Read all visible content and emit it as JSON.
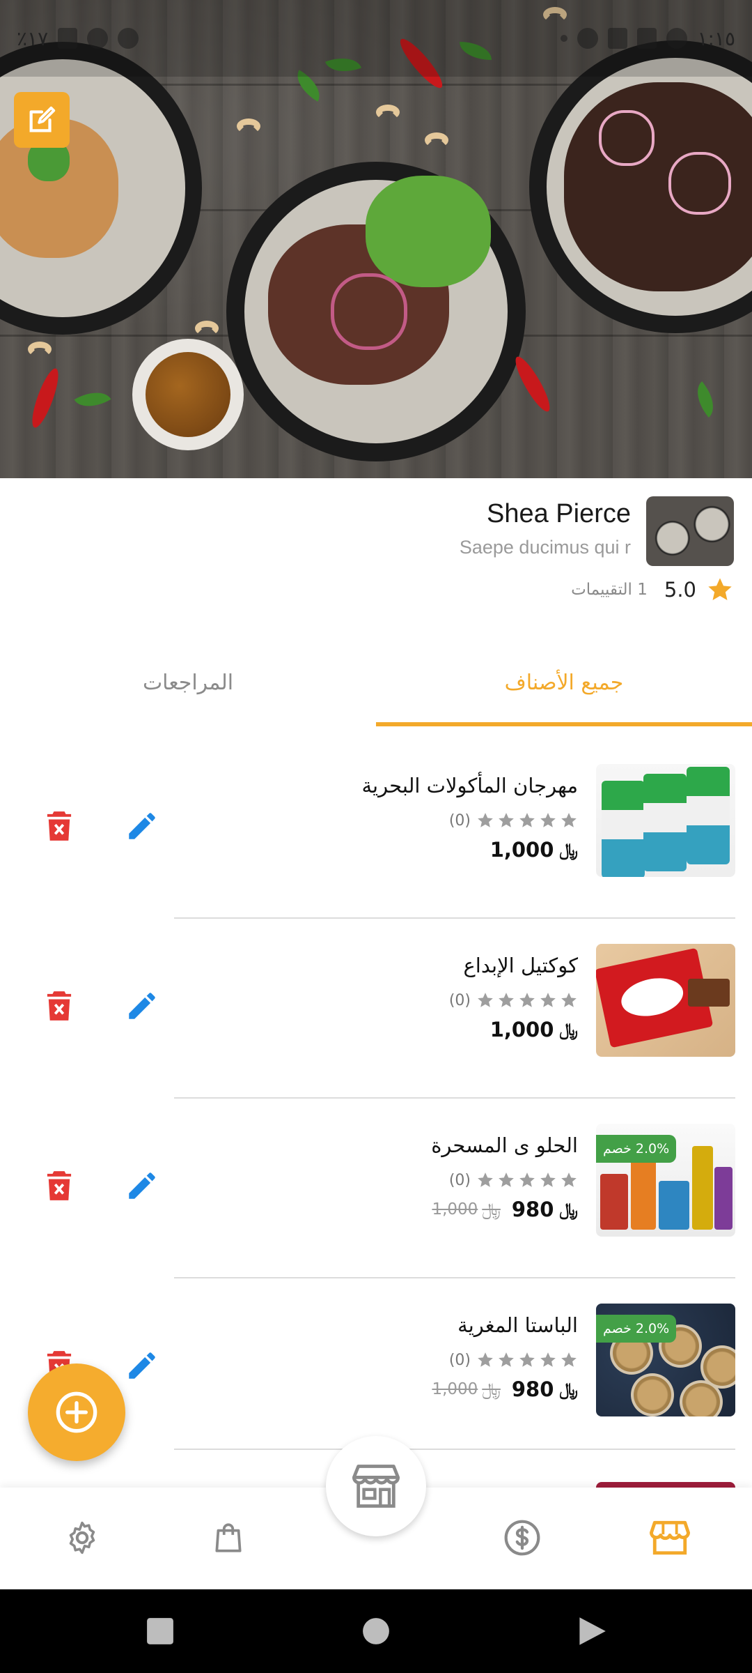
{
  "status_bar": {
    "battery": "٪١٧",
    "time": "١:١٥"
  },
  "store": {
    "name": "Shea Pierce",
    "description": "Saepe ducimus qui r",
    "rating_value": "5.0",
    "rating_count": "1 التقييمات"
  },
  "tabs": [
    {
      "label": "جميع الأصناف",
      "active": true
    },
    {
      "label": "المراجعات",
      "active": false
    }
  ],
  "products": [
    {
      "title": "مهرجان المأكولات البحرية",
      "reviews": "(0)",
      "price": "1,000",
      "currency": "﷼",
      "old_price": null,
      "discount": null
    },
    {
      "title": "كوكتيل الإبداع",
      "reviews": "(0)",
      "price": "1,000",
      "currency": "﷼",
      "old_price": null,
      "discount": null
    },
    {
      "title": "الحلو ى المسحرة",
      "reviews": "(0)",
      "price": "980",
      "currency": "﷼",
      "old_price": "1,000",
      "discount": "2.0% خصم"
    },
    {
      "title": "الباستا المغرية",
      "reviews": "(0)",
      "price": "980",
      "currency": "﷼",
      "old_price": "1,000",
      "discount": "2.0% خصم"
    }
  ],
  "colors": {
    "accent": "#f3a92a",
    "edit": "#1e88e5",
    "delete": "#e53935",
    "discount": "#43a047"
  },
  "icons": {
    "cover_edit": "edit-square-icon",
    "nav": [
      "settings-icon",
      "shopping-bag-icon",
      "store-icon",
      "dollar-icon",
      "storefront-icon"
    ],
    "fab": "add-circle-icon"
  }
}
